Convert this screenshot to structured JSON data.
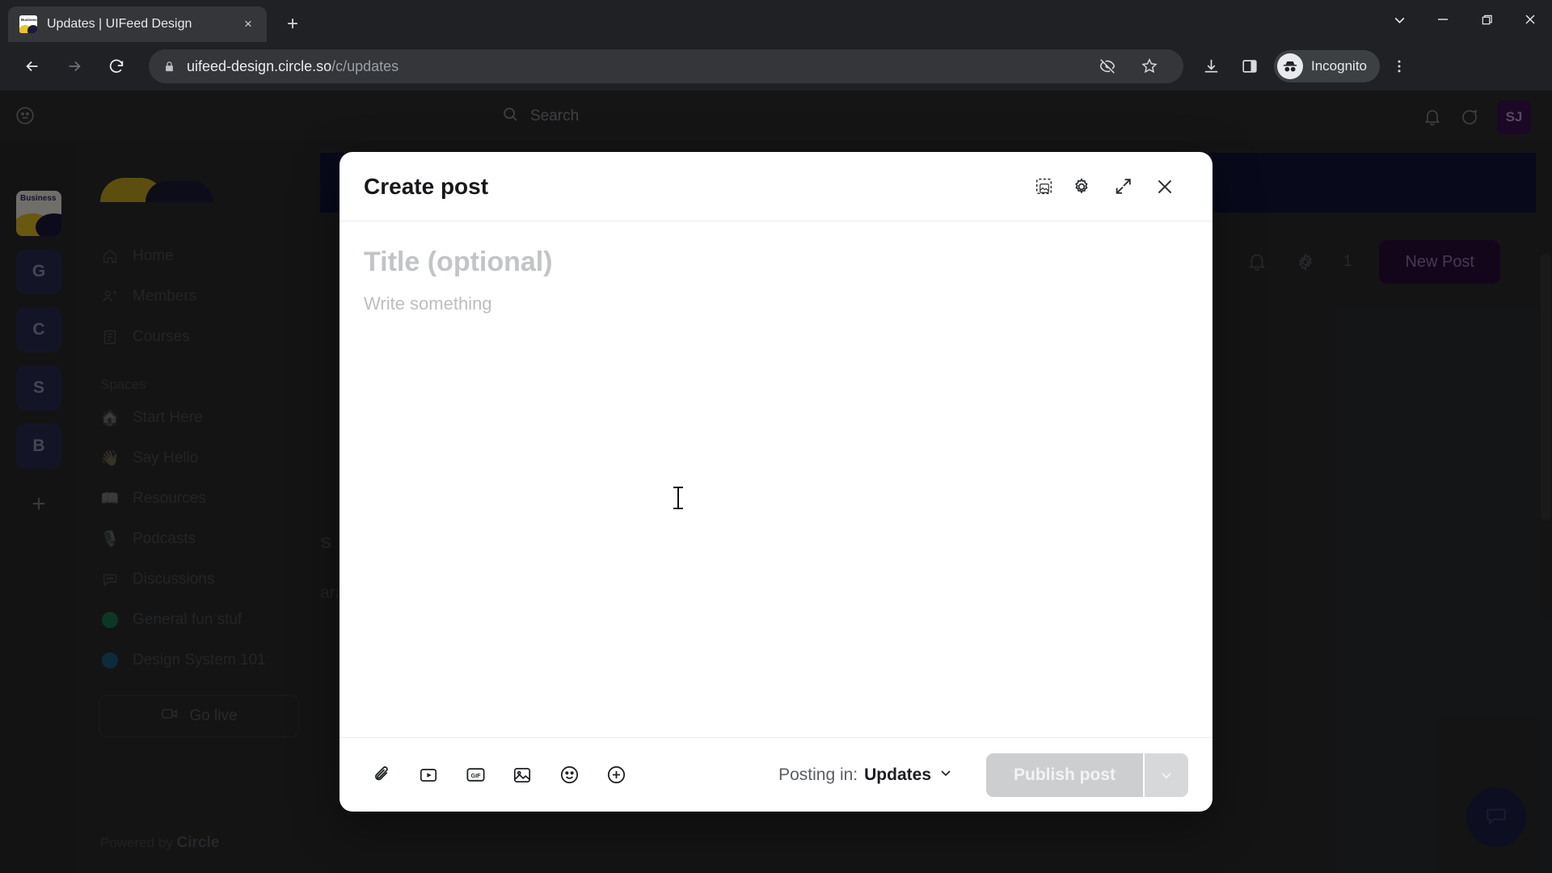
{
  "browser": {
    "tab": {
      "title": "Updates | UIFeed Design",
      "favicon_label": "Business",
      "close_label": "×"
    },
    "new_tab_label": "+",
    "window_controls": {
      "tab_search": "tab-search",
      "minimize": "minimize",
      "maximize": "maximize",
      "close": "close"
    },
    "nav": {
      "back": "back",
      "forward": "forward",
      "reload": "reload"
    },
    "omnibox": {
      "host": "uifeed-design.circle.so",
      "path": "/c/updates",
      "lock_icon": "lock-icon"
    },
    "toolbar_icons": [
      "eye-off-icon",
      "bookmark-star-icon",
      "download-icon",
      "side-panel-icon"
    ],
    "incognito_label": "Incognito",
    "menu_label": "⋮"
  },
  "app": {
    "header": {
      "search_placeholder": "Search",
      "notification_icon": "bell-icon",
      "messages_icon": "chat-bubble-icon",
      "avatar_initials": "SJ"
    },
    "rail": {
      "community_logo_label": "Business",
      "items": [
        {
          "label": "G",
          "name": "community-g"
        },
        {
          "label": "C",
          "name": "community-c"
        },
        {
          "label": "S",
          "name": "community-s"
        },
        {
          "label": "B",
          "name": "community-b"
        }
      ],
      "add_label": "+"
    },
    "sidebar": {
      "nav": [
        {
          "label": "Home",
          "icon": "home-icon"
        },
        {
          "label": "Members",
          "icon": "members-icon"
        },
        {
          "label": "Courses",
          "icon": "courses-icon"
        }
      ],
      "spaces_heading": "Spaces",
      "spaces": [
        {
          "label": "Start Here",
          "emoji": "🏠"
        },
        {
          "label": "Say Hello",
          "emoji": "👋"
        },
        {
          "label": "Resources",
          "emoji": "📖"
        },
        {
          "label": "Podcasts",
          "emoji": "🎙️"
        },
        {
          "label": "Discussions",
          "emoji": "💬"
        },
        {
          "label": "General fun stuf",
          "emoji": "🟢",
          "color": "#1c7a52"
        },
        {
          "label": "Design System 101",
          "emoji": "🔵",
          "color": "#1f5f86"
        }
      ],
      "go_live_label": "Go live",
      "powered_prefix": "Powered by ",
      "powered_brand": "Circle"
    },
    "content": {
      "notification_icon": "bell-icon",
      "settings_icon": "gear-icon",
      "member_count": "1",
      "new_post_label": "New Post",
      "bg_heading": "s",
      "bg_author": "arah Jonas",
      "chat_widget_icon": "chat-bubble-icon"
    }
  },
  "modal": {
    "title": "Create post",
    "header_actions": [
      {
        "name": "cover-image-icon",
        "label": "cover-image"
      },
      {
        "name": "gear-icon",
        "label": "settings"
      },
      {
        "name": "expand-icon",
        "label": "expand"
      },
      {
        "name": "close-icon",
        "label": "close"
      }
    ],
    "title_placeholder": "Title (optional)",
    "body_placeholder": "Write something",
    "title_value": "",
    "body_value": "",
    "footer_icons": [
      {
        "name": "attachment-icon",
        "label": "Attach file"
      },
      {
        "name": "video-icon",
        "label": "Video"
      },
      {
        "name": "gif-icon",
        "label": "GIF"
      },
      {
        "name": "image-icon",
        "label": "Image"
      },
      {
        "name": "emoji-icon",
        "label": "Emoji"
      },
      {
        "name": "more-plus-icon",
        "label": "More"
      }
    ],
    "gif_label": "GIF",
    "posting_in_prefix": "Posting in:",
    "posting_in_space": "Updates",
    "publish_label": "Publish post",
    "publish_disabled": true
  },
  "colors": {
    "chrome_bg": "#202124",
    "app_bg": "#2d2e30",
    "banner": "#13153a",
    "accent_purple": "#2b0f3a",
    "modal_bg": "#ffffff",
    "publish_disabled": "#cdced0"
  }
}
